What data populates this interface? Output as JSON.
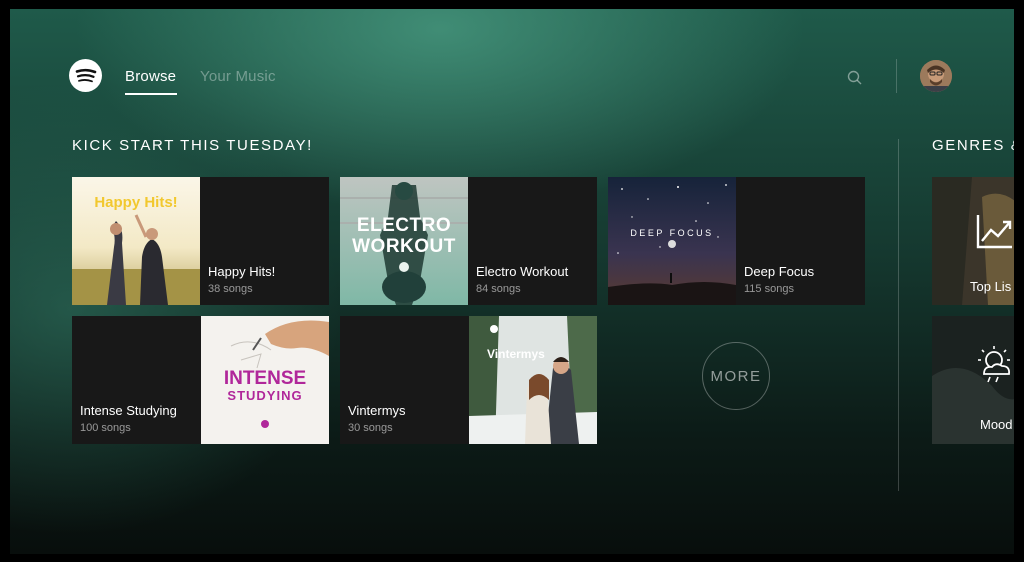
{
  "header": {
    "nav": {
      "browse": "Browse",
      "your_music": "Your Music"
    }
  },
  "section": {
    "title": "KICK START THIS TUESDAY!"
  },
  "playlists": [
    {
      "name": "Happy Hits!",
      "count": "38 songs",
      "art_text": "Happy Hits!"
    },
    {
      "name": "Electro Workout",
      "count": "84 songs",
      "art_line1": "ELECTRO",
      "art_line2": "WORKOUT"
    },
    {
      "name": "Deep Focus",
      "count": "115 songs",
      "art_text": "DEEP FOCUS"
    },
    {
      "name": "Intense Studying",
      "count": "100 songs",
      "art_line1": "INTENSE",
      "art_line2": "STUDYING"
    },
    {
      "name": "Vintermys",
      "count": "30 songs",
      "art_text": "Vintermys"
    }
  ],
  "more_button": {
    "label": "MORE"
  },
  "genres": {
    "title": "GENRES &",
    "items": [
      {
        "label": "Top Lis"
      },
      {
        "label": "Mood"
      }
    ]
  },
  "colors": {
    "accent": "#ffffff",
    "intense_purple": "#b0279a",
    "happy_yellow": "#f2c82e"
  }
}
